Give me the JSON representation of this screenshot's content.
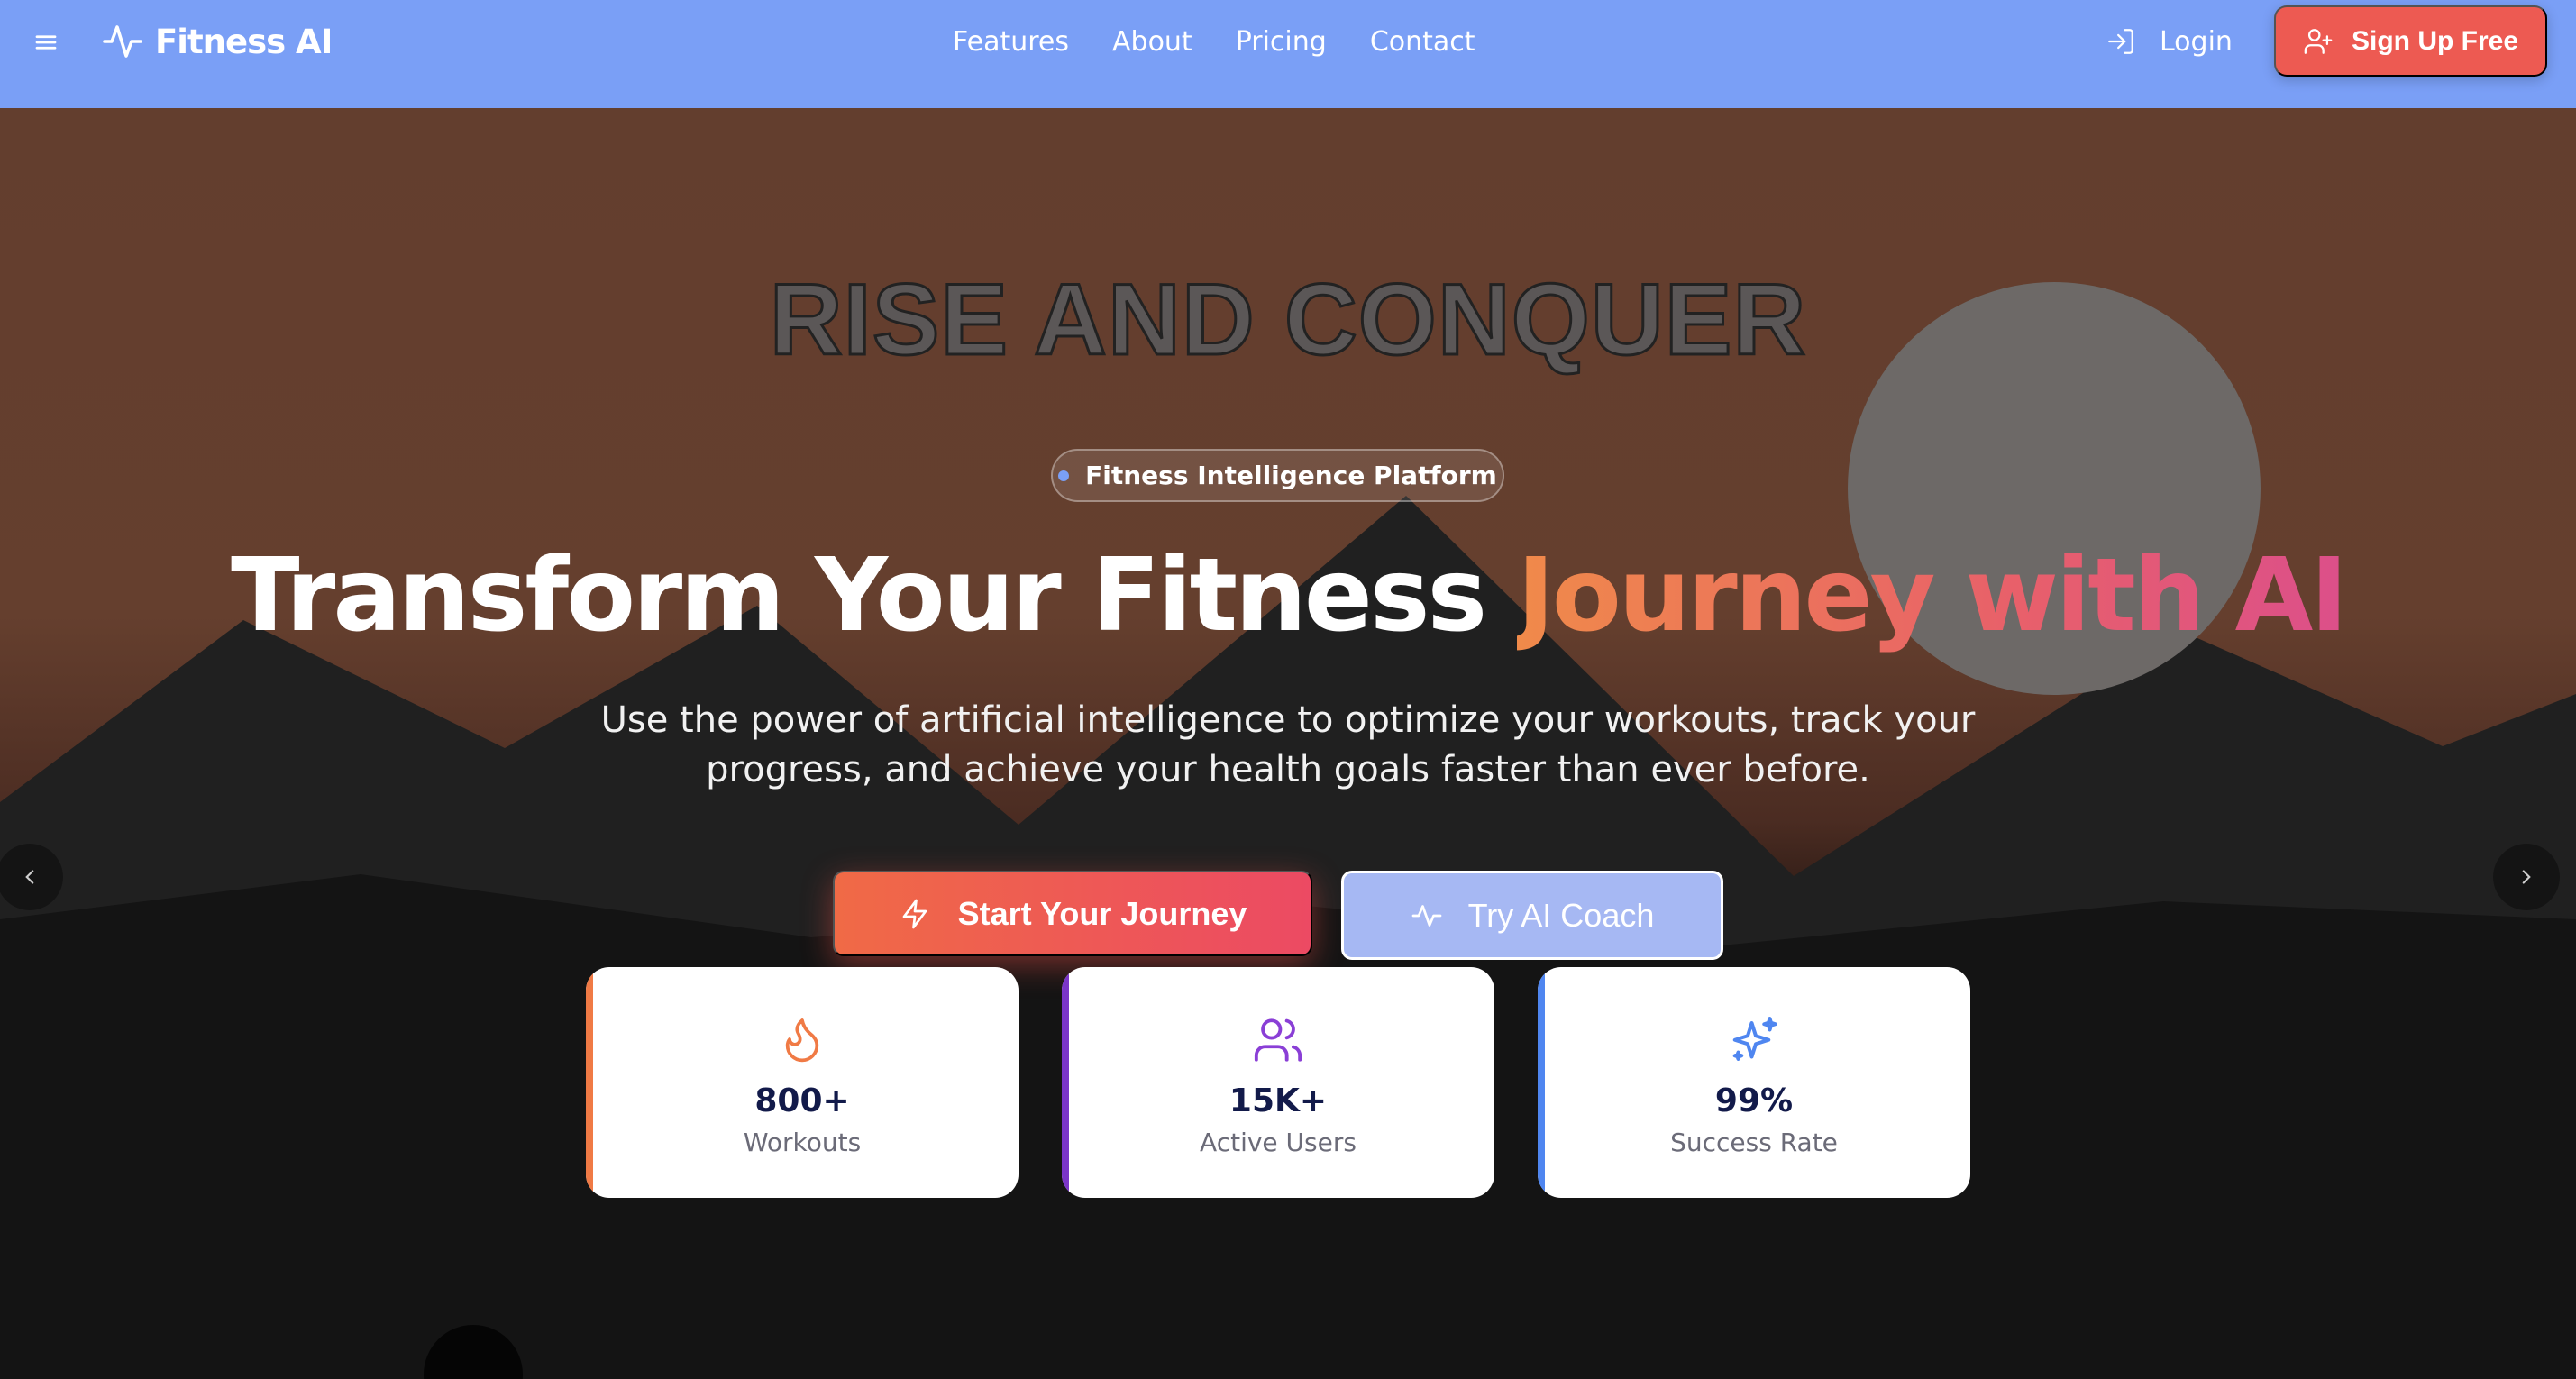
{
  "navbar": {
    "menu_icon": "hamburger-menu-icon",
    "brand_icon": "pulse-icon",
    "brand": "Fitness AI",
    "links": [
      "Features",
      "About",
      "Pricing",
      "Contact"
    ],
    "login_icon": "login-arrow-icon",
    "login": "Login",
    "signup_icon": "user-plus-icon",
    "signup": "Sign Up Free",
    "background_color": "#7a9ff6"
  },
  "hero": {
    "banner_text": "RISE AND CONQUER",
    "badge": "Fitness Intelligence Platform",
    "headline_part1": "Transform Your Fitness ",
    "headline_part2": "Journey with AI",
    "subtitle": "Use the power of artificial intelligence to optimize your workouts, track your progress, and achieve your health goals faster than ever before.",
    "primary_button": {
      "icon": "lightning-icon",
      "label": "Start Your Journey"
    },
    "secondary_button": {
      "icon": "pulse-icon",
      "label": "Try AI Coach"
    },
    "prev_arrow": "chevron-left-icon",
    "next_arrow": "chevron-right-icon"
  },
  "stats": [
    {
      "icon": "flame-icon",
      "value": "800+",
      "label": "Workouts",
      "color": "#f07a45"
    },
    {
      "icon": "users-icon",
      "value": "15K+",
      "label": "Active Users",
      "color": "#7a35c8"
    },
    {
      "icon": "sparkle-icon",
      "value": "99%",
      "label": "Success Rate",
      "color": "#4f86f0"
    }
  ],
  "colors": {
    "accent_coral": "#ed5a52",
    "gradient_orange": "#f08a4a",
    "gradient_pink": "#dc4f8a",
    "stat_value_navy": "#121a4a"
  }
}
